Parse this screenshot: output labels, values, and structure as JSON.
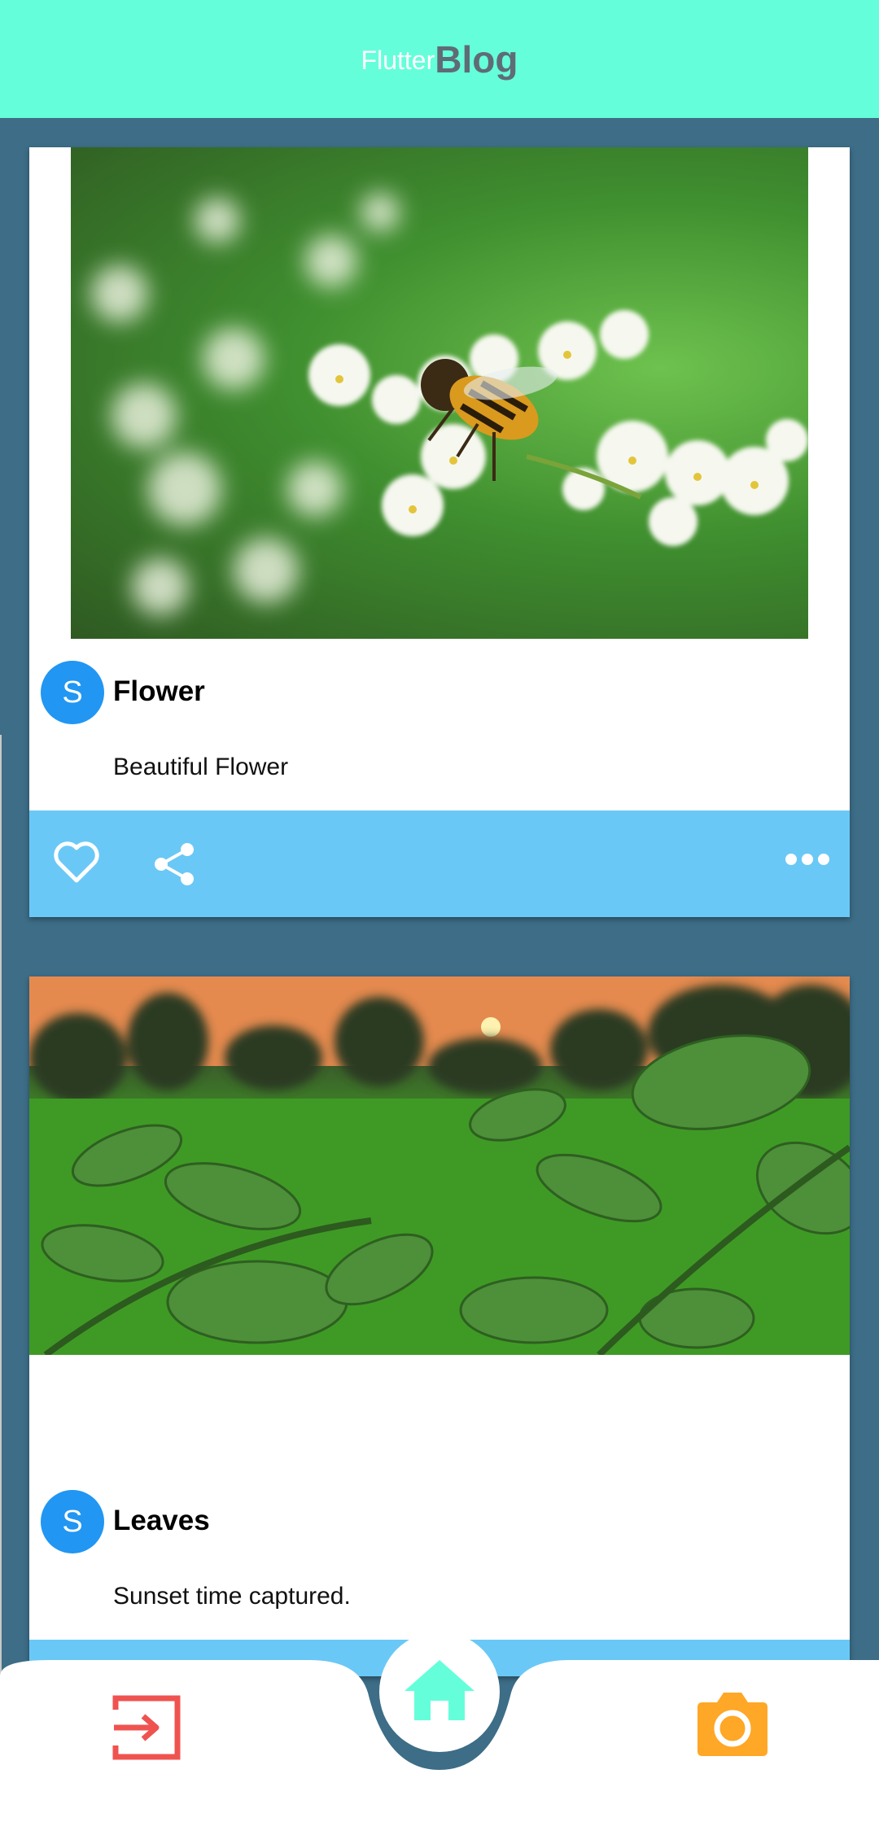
{
  "appbar": {
    "title_part1": "Flutter",
    "title_part2": "Blog"
  },
  "posts": [
    {
      "avatar": "S",
      "title": "Flower",
      "body": "Beautiful Flower",
      "image_subject": "bee on white flowers"
    },
    {
      "avatar": "S",
      "title": "Leaves",
      "body": "Sunset time captured.",
      "image_subject": "green leaves and field at sunset"
    }
  ],
  "actions": {
    "like_icon": "heart-icon",
    "share_icon": "share-icon",
    "more_icon": "more-horizontal-icon"
  },
  "bottom_nav": {
    "left_icon": "login-icon",
    "center_icon": "home-icon",
    "right_icon": "camera-icon"
  },
  "colors": {
    "appbar": "#64ffda",
    "background": "#3d6d87",
    "action_bar": "#6ac8f6",
    "avatar": "#2196f3",
    "login_icon": "#ef5350",
    "home_icon": "#64ffda",
    "camera_icon": "#ffa726"
  }
}
